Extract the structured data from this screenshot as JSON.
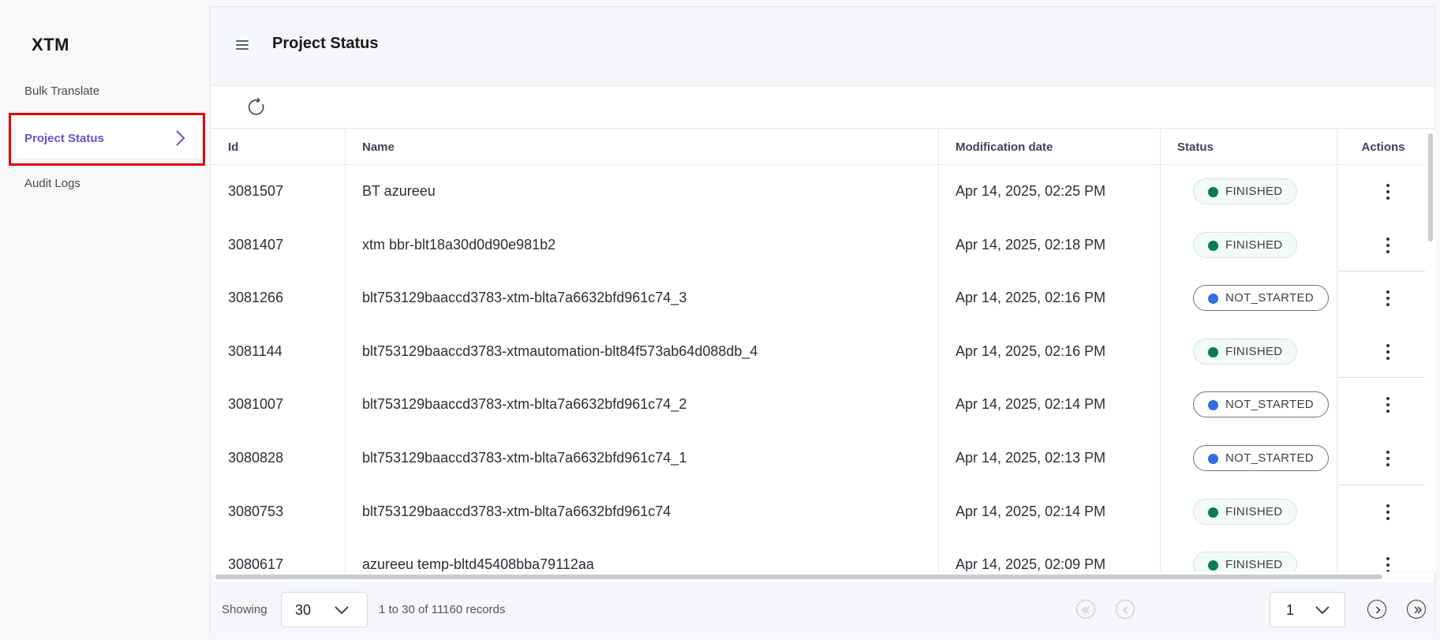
{
  "sidebar": {
    "brand": "XTM",
    "items": [
      {
        "label": "Bulk Translate"
      },
      {
        "label": "Project Status",
        "active": true
      },
      {
        "label": "Audit Logs"
      }
    ]
  },
  "header": {
    "title": "Project Status"
  },
  "table": {
    "columns": [
      "Id",
      "Name",
      "Modification date",
      "Status",
      "Actions"
    ],
    "rows": [
      {
        "id": "3081507",
        "name": "BT azureeu",
        "modified": "Apr 14, 2025, 02:25 PM",
        "status": "FINISHED"
      },
      {
        "id": "3081407",
        "name": "xtm bbr-blt18a30d0d90e981b2",
        "modified": "Apr 14, 2025, 02:18 PM",
        "status": "FINISHED"
      },
      {
        "id": "3081266",
        "name": "blt753129baaccd3783-xtm-blta7a6632bfd961c74_3",
        "modified": "Apr 14, 2025, 02:16 PM",
        "status": "NOT_STARTED"
      },
      {
        "id": "3081144",
        "name": "blt753129baaccd3783-xtmautomation-blt84f573ab64d088db_4",
        "modified": "Apr 14, 2025, 02:16 PM",
        "status": "FINISHED"
      },
      {
        "id": "3081007",
        "name": "blt753129baaccd3783-xtm-blta7a6632bfd961c74_2",
        "modified": "Apr 14, 2025, 02:14 PM",
        "status": "NOT_STARTED"
      },
      {
        "id": "3080828",
        "name": "blt753129baaccd3783-xtm-blta7a6632bfd961c74_1",
        "modified": "Apr 14, 2025, 02:13 PM",
        "status": "NOT_STARTED"
      },
      {
        "id": "3080753",
        "name": "blt753129baaccd3783-xtm-blta7a6632bfd961c74",
        "modified": "Apr 14, 2025, 02:14 PM",
        "status": "FINISHED"
      },
      {
        "id": "3080617",
        "name": "azureeu temp-bltd45408bba79112aa",
        "modified": "Apr 14, 2025, 02:09 PM",
        "status": "FINISHED"
      }
    ]
  },
  "status_colors": {
    "FINISHED": "#0a7a52",
    "NOT_STARTED": "#2f6fe0"
  },
  "footer": {
    "showing_label": "Showing",
    "page_size": "30",
    "records_text": "1 to 30 of 11160 records",
    "current_page": "1"
  },
  "icons": {
    "menu": "hamburger-icon",
    "refresh": "refresh-icon",
    "chevron": "chevron-right-icon",
    "kebab": "kebab-menu-icon",
    "first": "first-page-icon",
    "prev": "previous-page-icon",
    "next": "next-page-icon",
    "last": "last-page-icon"
  },
  "accent_color": "#6b4fc7"
}
